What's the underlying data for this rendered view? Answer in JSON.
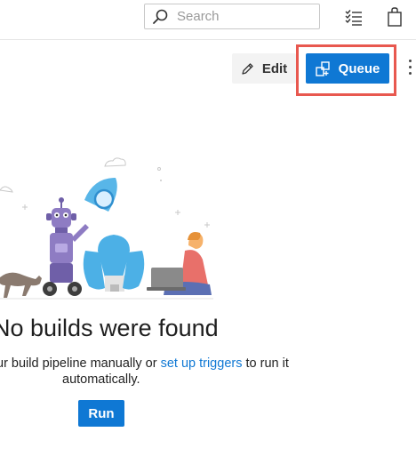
{
  "header": {
    "search": {
      "placeholder": "Search",
      "icon": "search-icon"
    },
    "icons": [
      "list-settings-icon",
      "shopping-bag-icon"
    ]
  },
  "actions": {
    "edit_label": "Edit",
    "queue_label": "Queue",
    "more_icon": "more-vertical-icon"
  },
  "empty_state": {
    "title": "No builds were found",
    "desc_before": "ur build pipeline manually or ",
    "desc_link": "set up triggers",
    "desc_after": " to run it",
    "desc_line2": "automatically.",
    "run_label": "Run"
  },
  "colors": {
    "accent": "#0f78d4",
    "highlight": "#e8584f",
    "edit_bg": "#f3f3f3"
  }
}
